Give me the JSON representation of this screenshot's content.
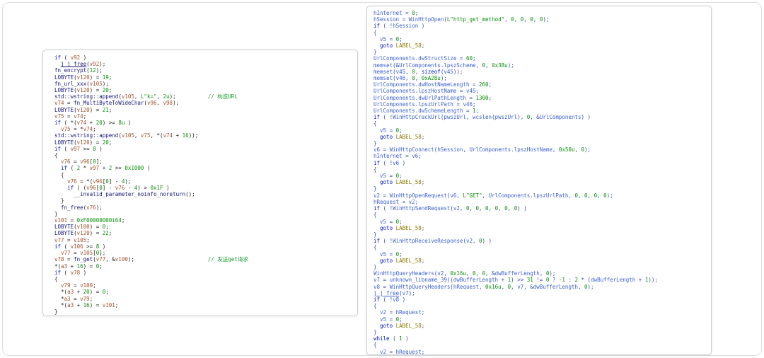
{
  "colors": {
    "keyword": "#0014c8",
    "number": "#0a8f0a",
    "string": "#0a8f0a",
    "comment": "#149e2a",
    "label": "#8a7a00",
    "left_identifier": "#141478",
    "left_variable": "#a1522c",
    "left_base": "#1c1c1c",
    "right_identifier": "#3a5fd2",
    "right_base": "#2b49b8",
    "panel_border": "#c9ccd1"
  },
  "panels": {
    "left": {
      "lines": [
        "if ( v92 )",
        "  j_j_free(v92);",
        "fn_encrypt(12);",
        "LOBYTE(v120) = 19;",
        "fn_url_xxx(v105);",
        "LOBYTE(v120) = 20;",
        "std::wstring::append(v105, L\"k=\", 2u);          // 构造URL",
        "v74 = fn_MultiByteToWideChar(v96, v98);",
        "LOBYTE(v120) = 21;",
        "v75 = v74;",
        "if ( *(v74 + 20) >= 8u )",
        "  v75 = *v74;",
        "std::wstring::append(v105, v75, *(v74 + 16));",
        "LOBYTE(v120) = 20;",
        "if ( v97 >= 8 )",
        "{",
        "  v76 = v96[0];",
        "  if ( 2 * v97 + 2 >= 0x1000 )",
        "  {",
        "    v76 = *(v96[0] - 4);",
        "    if ( (v96[0] - v76 - 4) > 0x1F )",
        "      __invalid_parameter_noinfo_noreturn();",
        "  }",
        "  fn_free(v76);",
        "}",
        "v101 = 0xF00000000i64;",
        "LOBYTE(v100) = 0;",
        "LOBYTE(v120) = 22;",
        "v77 = v105;",
        "if ( v106 >= 8 )",
        "  v77 = v105[0];",
        "v78 = fn_get(v77, &v100);                       // 发送get请求",
        "*(a3 + 16) = 0;",
        "if ( v78 )",
        "{",
        "  v79 = v100;",
        "  *(a3 + 20) = 0;",
        "  *a3 = v79;",
        "  *(a3 + 16) = v101;",
        "}"
      ]
    },
    "right": {
      "lines": [
        "hInternet = 0;",
        "hSession = WinHttpOpen(L\"http_get_method\", 0, 0, 0, 0);",
        "if ( !hSession )",
        "{",
        "  v5 = 0;",
        "  goto LABEL_58;",
        "}",
        "UrlComponents.dwStructSize = 60;",
        "memset(&UrlComponents.lpszScheme, 0, 0x38u);",
        "memset(v45, 0, sizeof(v45));",
        "memset(v46, 0, 0xA28u);",
        "UrlComponents.dwHostNameLength = 260;",
        "UrlComponents.lpszHostName = v45;",
        "UrlComponents.dwUrlPathLength = 1300;",
        "UrlComponents.lpszUrlPath = v46;",
        "UrlComponents.dwSchemeLength = 1;",
        "if ( !WinHttpCrackUrl(pwszUrl, wcslen(pwszUrl), 0, &UrlComponents) )",
        "{",
        "  v5 = 0;",
        "  goto LABEL_58;",
        "}",
        "v6 = WinHttpConnect(hSession, UrlComponents.lpszHostName, 0x50u, 0);",
        "hInternet = v6;",
        "if ( !v6 )",
        "{",
        "  v5 = 0;",
        "  goto LABEL_58;",
        "}",
        "v2 = WinHttpOpenRequest(v6, L\"GET\", UrlComponents.lpszUrlPath, 0, 0, 0, 0);",
        "hRequest = v2;",
        "if ( !WinHttpSendRequest(v2, 0, 0, 0, 0, 0, 0) )",
        "{",
        "  v5 = 0;",
        "  goto LABEL_58;",
        "}",
        "if ( !WinHttpReceiveResponse(v2, 0) )",
        "{",
        "  v5 = 0;",
        "  goto LABEL_58;",
        "}",
        "WinHttpQueryHeaders(v2, 0x16u, 0, 0, &dwBufferLength, 0);",
        "v7 = unknown_libname_39((dwBufferLength + 1) >> 31 != 0 ? -1 : 2 * (dwBufferLength + 1));",
        "v8 = WinHttpQueryHeaders(hRequest, 0x16u, 0, v7, &dwBufferLength, 0);",
        "j_j_free(v7);",
        "if ( !v8 )",
        "{",
        "  v2 = hRequest;",
        "  v5 = 0;",
        "  goto LABEL_58;",
        "}",
        "while ( 1 )",
        "{",
        "  v2 = hRequest;"
      ]
    }
  }
}
